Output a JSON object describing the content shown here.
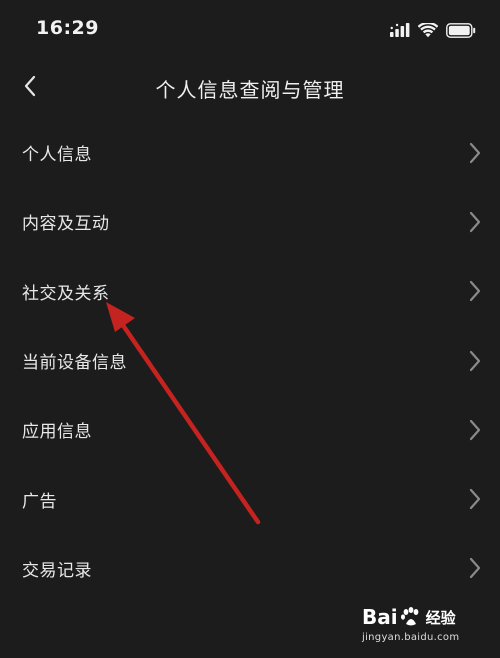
{
  "status_bar": {
    "time": "16:29"
  },
  "nav": {
    "title": "个人信息查阅与管理"
  },
  "menu": {
    "items": [
      {
        "label": "个人信息"
      },
      {
        "label": "内容及互动"
      },
      {
        "label": "社交及关系"
      },
      {
        "label": "当前设备信息"
      },
      {
        "label": "应用信息"
      },
      {
        "label": "广告"
      },
      {
        "label": "交易记录"
      }
    ]
  },
  "watermark": {
    "brand_left": "Bai",
    "brand_right": "经验",
    "url": "jingyan.baidu.com"
  },
  "colors": {
    "background": "#1c1c1c",
    "text": "#e8e8e8",
    "chevron": "#8a8a8a",
    "arrow": "#c4231f"
  },
  "icons": {
    "back": "chevron-left-icon",
    "row": "chevron-right-icon",
    "signal": "cellular-signal-icon",
    "wifi": "wifi-icon",
    "battery": "battery-icon"
  }
}
